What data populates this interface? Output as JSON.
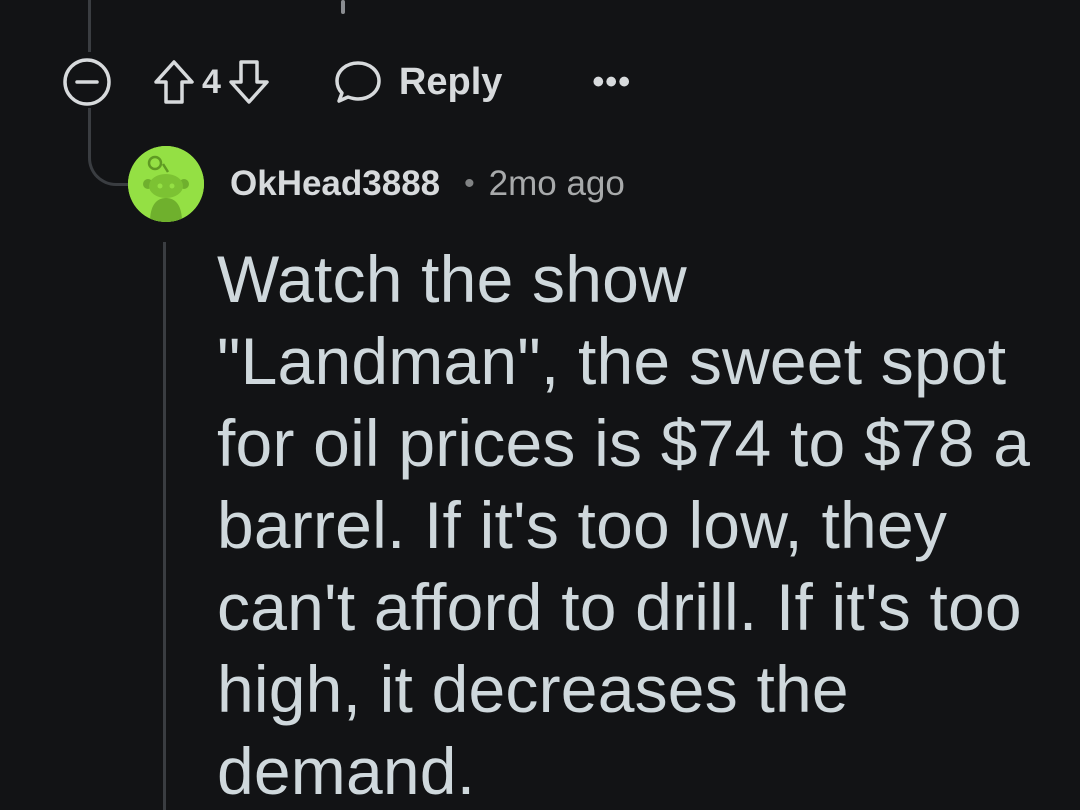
{
  "parent_comment": {
    "score": "4",
    "reply_label": "Reply",
    "more_label": "•••"
  },
  "comment": {
    "username": "OkHead3888",
    "separator": "•",
    "timestamp": "2mo ago",
    "body": "Watch the show \"Landman\", the sweet spot for oil prices is $74 to $78 a barrel. If it's too low, they can't afford to drill. If it's too high, it decreases the demand."
  },
  "colors": {
    "background": "#121315",
    "text": "#d7dadc",
    "avatar_bg": "#94e044",
    "thread_line": "#3a3d41"
  },
  "icons": {
    "collapse": "collapse-minus-icon",
    "upvote": "upvote-arrow-icon",
    "downvote": "downvote-arrow-icon",
    "reply": "speech-bubble-icon",
    "more": "ellipsis-icon",
    "avatar": "snoo-avatar-icon"
  }
}
